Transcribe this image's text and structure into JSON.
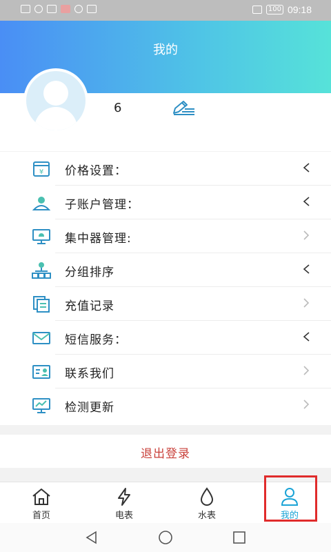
{
  "status_bar": {
    "time": "09:18",
    "battery": "100"
  },
  "header": {
    "title": "我的"
  },
  "profile": {
    "username": "6"
  },
  "menu": [
    {
      "label": "价格设置：",
      "icon": "price-icon",
      "arrow": "expand"
    },
    {
      "label": "子账户管理：",
      "icon": "subaccount-icon",
      "arrow": "expand"
    },
    {
      "label": "集中器管理:",
      "icon": "concentrator-icon",
      "arrow": "chevron"
    },
    {
      "label": "分组排序",
      "icon": "group-icon",
      "arrow": "expand"
    },
    {
      "label": "充值记录",
      "icon": "recharge-icon",
      "arrow": "chevron"
    },
    {
      "label": "短信服务：",
      "icon": "sms-icon",
      "arrow": "expand"
    },
    {
      "label": "联系我们",
      "icon": "contact-icon",
      "arrow": "chevron"
    },
    {
      "label": "检测更新",
      "icon": "update-icon",
      "arrow": "chevron"
    }
  ],
  "logout": {
    "label": "退出登录"
  },
  "tabs": [
    {
      "label": "首页",
      "icon": "home-icon",
      "active": false
    },
    {
      "label": "电表",
      "icon": "lightning-icon",
      "active": false
    },
    {
      "label": "水表",
      "icon": "water-drop-icon",
      "active": false
    },
    {
      "label": "我的",
      "icon": "person-icon",
      "active": true
    }
  ],
  "colors": {
    "accent": "#1aa3d6",
    "logout": "#c9413b",
    "icon": "#2d8fc4",
    "highlight": "#e02b2b"
  }
}
